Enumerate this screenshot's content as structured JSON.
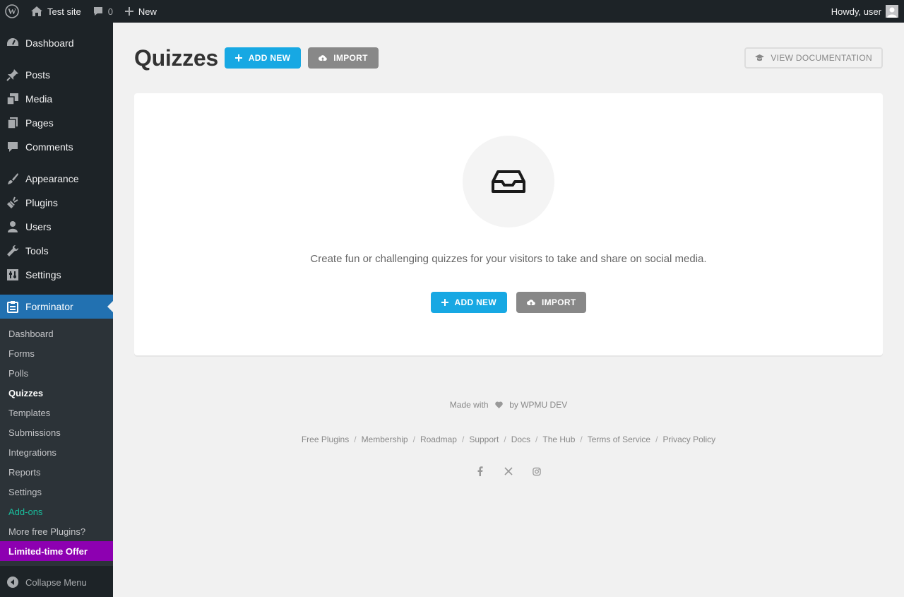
{
  "admin_bar": {
    "site_name": "Test site",
    "comments_count": "0",
    "new_label": "New",
    "greeting": "Howdy, user"
  },
  "sidebar": {
    "items": [
      {
        "label": "Dashboard",
        "icon": "dashboard-icon"
      },
      {
        "label": "Posts",
        "icon": "pin-icon"
      },
      {
        "label": "Media",
        "icon": "media-icon"
      },
      {
        "label": "Pages",
        "icon": "pages-icon"
      },
      {
        "label": "Comments",
        "icon": "comment-icon"
      },
      {
        "label": "Appearance",
        "icon": "brush-icon"
      },
      {
        "label": "Plugins",
        "icon": "plug-icon"
      },
      {
        "label": "Users",
        "icon": "user-icon"
      },
      {
        "label": "Tools",
        "icon": "wrench-icon"
      },
      {
        "label": "Settings",
        "icon": "settings-icon"
      },
      {
        "label": "Forminator",
        "icon": "clipboard-icon"
      }
    ],
    "submenu": [
      "Dashboard",
      "Forms",
      "Polls",
      "Quizzes",
      "Templates",
      "Submissions",
      "Integrations",
      "Reports",
      "Settings",
      "Add-ons",
      "More free Plugins?",
      "Limited-time Offer"
    ],
    "collapse_label": "Collapse Menu"
  },
  "main": {
    "title": "Quizzes",
    "add_new_label": "ADD NEW",
    "import_label": "IMPORT",
    "doc_label": "VIEW DOCUMENTATION",
    "empty_message": "Create fun or challenging quizzes for your visitors to take and share on social media."
  },
  "footer": {
    "made_with": "Made with",
    "by": "by WPMU DEV",
    "links": [
      "Free Plugins",
      "Membership",
      "Roadmap",
      "Support",
      "Docs",
      "The Hub",
      "Terms of Service",
      "Privacy Policy"
    ],
    "separator": "/"
  },
  "colors": {
    "accent": "#17a8e3",
    "sidebar_bg": "#1d2327",
    "active_menu": "#2271b1",
    "offer": "#8d00b1",
    "addons": "#1abc9c"
  }
}
